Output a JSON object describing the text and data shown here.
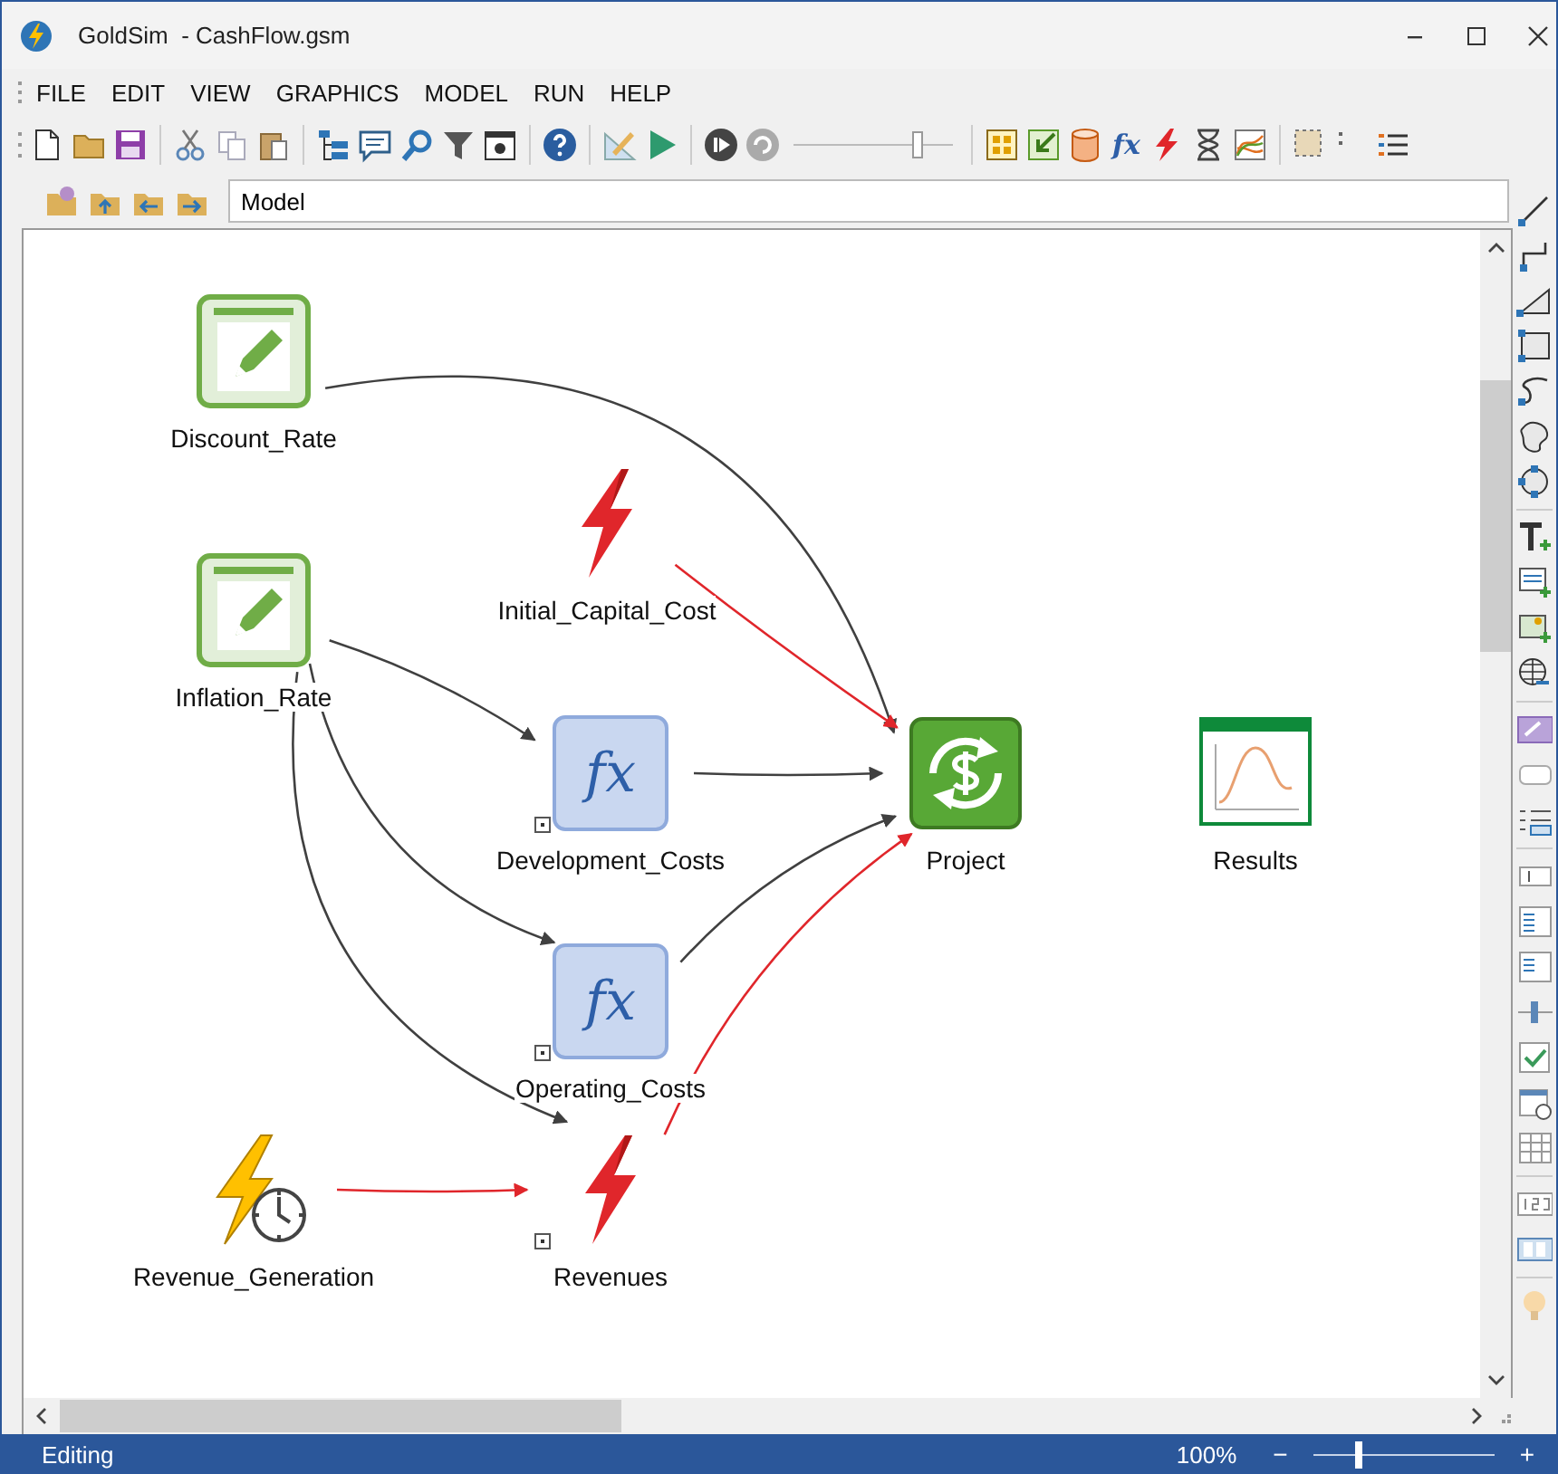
{
  "window": {
    "title": "GoldSim  - CashFlow.gsm"
  },
  "menu": [
    {
      "label": "FILE"
    },
    {
      "label": "EDIT"
    },
    {
      "label": "VIEW"
    },
    {
      "label": "GRAPHICS"
    },
    {
      "label": "MODEL"
    },
    {
      "label": "RUN"
    },
    {
      "label": "HELP"
    }
  ],
  "toolbar": {
    "function_glyph": "fx"
  },
  "path_field": {
    "value": "Model"
  },
  "diagram": {
    "nodes": [
      {
        "kind": "data",
        "label": "Discount_Rate",
        "detail_marker": false
      },
      {
        "kind": "data",
        "label": "Inflation_Rate",
        "detail_marker": false
      },
      {
        "kind": "event",
        "label": "Initial_Capital_Cost",
        "detail_marker": false
      },
      {
        "kind": "expression",
        "label": "Development_Costs",
        "glyph": "fx",
        "detail_marker": true
      },
      {
        "kind": "container",
        "label": "Project",
        "detail_marker": false
      },
      {
        "kind": "result",
        "label": "Results",
        "detail_marker": false
      },
      {
        "kind": "expression",
        "label": "Operating_Costs",
        "glyph": "fx",
        "detail_marker": true
      },
      {
        "kind": "timed_event",
        "label": "Revenue_Generation",
        "detail_marker": false
      },
      {
        "kind": "event",
        "label": "Revenues",
        "detail_marker": true
      }
    ],
    "links": [
      {
        "color": "#404040"
      },
      {
        "color": "#e0262b"
      },
      {
        "color": "#404040"
      },
      {
        "color": "#404040"
      },
      {
        "color": "#404040"
      },
      {
        "color": "#404040"
      },
      {
        "color": "#404040"
      },
      {
        "color": "#e0262b"
      },
      {
        "color": "#e0262b"
      }
    ]
  },
  "status_bar": {
    "mode": "Editing",
    "zoom": "100%",
    "zoom_out": "−",
    "zoom_in": "+",
    "zoom_slider": {
      "level": 0.25
    }
  }
}
